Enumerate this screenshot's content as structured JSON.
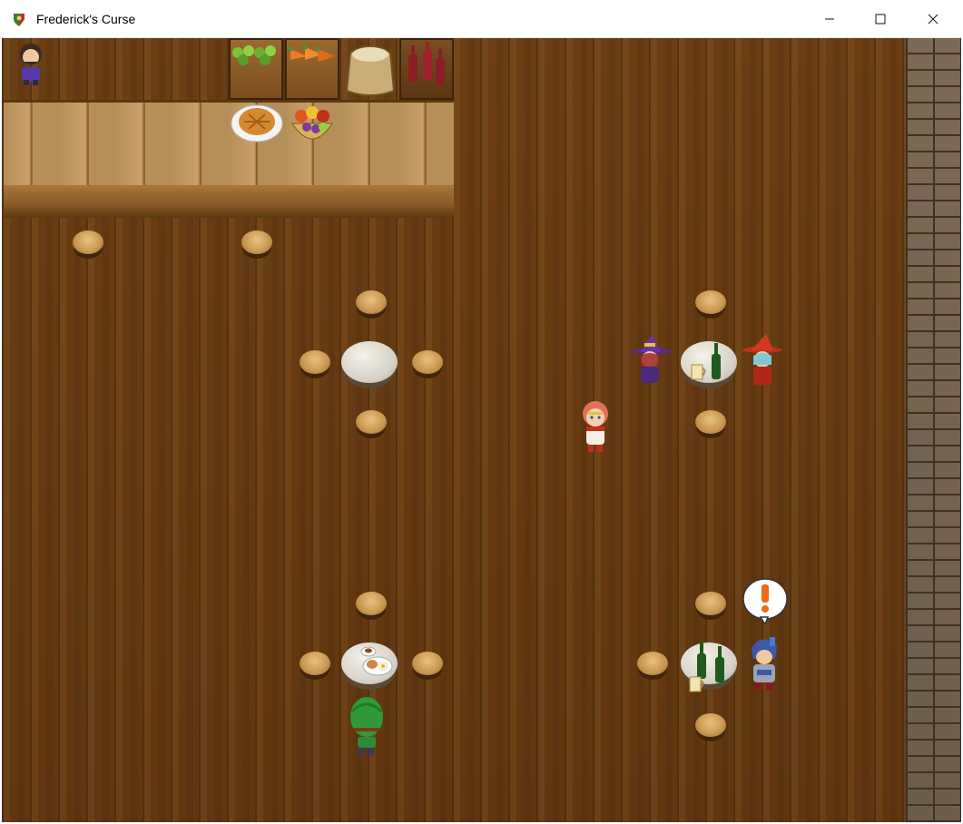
{
  "window": {
    "title": "Frederick's Curse",
    "controls": {
      "minimize": "minimize",
      "maximize": "maximize",
      "close": "close"
    }
  },
  "scene": {
    "type": "tavern-interior",
    "colors": {
      "floor": "#603610",
      "stone_wall": "#6c5c4a",
      "counter": "#b68e57"
    },
    "characters": [
      {
        "id": "shopkeeper",
        "icon": "shopkeeper-sprite"
      },
      {
        "id": "witch-purple",
        "icon": "witch-sprite"
      },
      {
        "id": "mage-red-hat",
        "icon": "mage-sprite"
      },
      {
        "id": "player-heroine",
        "icon": "heroine-sprite"
      },
      {
        "id": "knight-blue",
        "icon": "knight-sprite",
        "emote": "exclamation"
      },
      {
        "id": "green-haired-patron",
        "icon": "green-hair-sprite"
      }
    ],
    "items": [
      "apple-crate",
      "carrot-crate",
      "grain-sack",
      "wine-rack",
      "pie",
      "fruit-basket",
      "wine-bottle",
      "beer-mug",
      "plate-food"
    ]
  }
}
